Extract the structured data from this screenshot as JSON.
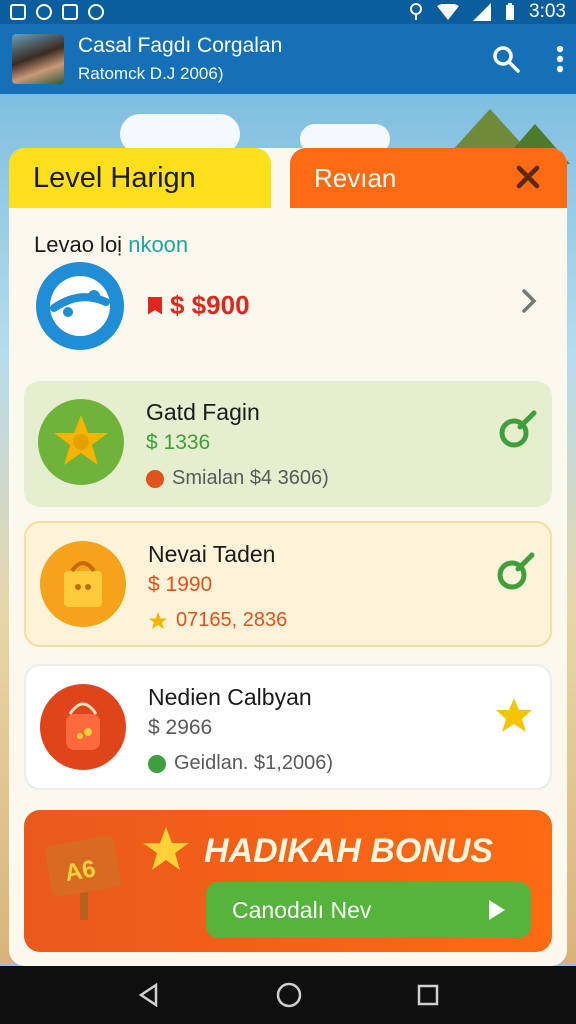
{
  "status_bar": {
    "time": "3:03"
  },
  "app_bar": {
    "title": "Casal Fagdı Corgalan",
    "subtitle": "Ratomck D.J 2006)"
  },
  "tabs": [
    {
      "label": "Level Harign"
    },
    {
      "label": "Revıan"
    }
  ],
  "level": {
    "title_prefix": "Levao loị",
    "title_highlight": "nkoon",
    "price": "$ $900"
  },
  "items": [
    {
      "name": "Gatd Fagin",
      "price": "$ 1336",
      "meta": "Smialan $4 3606)",
      "price_color": "#3f9f3a",
      "dot_color": "#e0531d"
    },
    {
      "name": "Nevai Taden",
      "price": "$ 1990",
      "meta": "07165, 2836",
      "price_color": "#e0531d",
      "dot_color": "#f4b400"
    },
    {
      "name": "Nedien Calbyan",
      "price": "$ 2966",
      "meta": "Geidlan. $1,2006)",
      "price_color": "#5a5a5a",
      "dot_color": "#3f9f3a"
    }
  ],
  "bonus": {
    "title": "HADIKAH BONUS",
    "button_label": "Canodalı Nev",
    "sign_text": "A6"
  },
  "colors": {
    "primary": "#1670b8",
    "accent_yellow": "#ffe01b",
    "accent_orange": "#ff6a12",
    "green": "#55b43b"
  }
}
